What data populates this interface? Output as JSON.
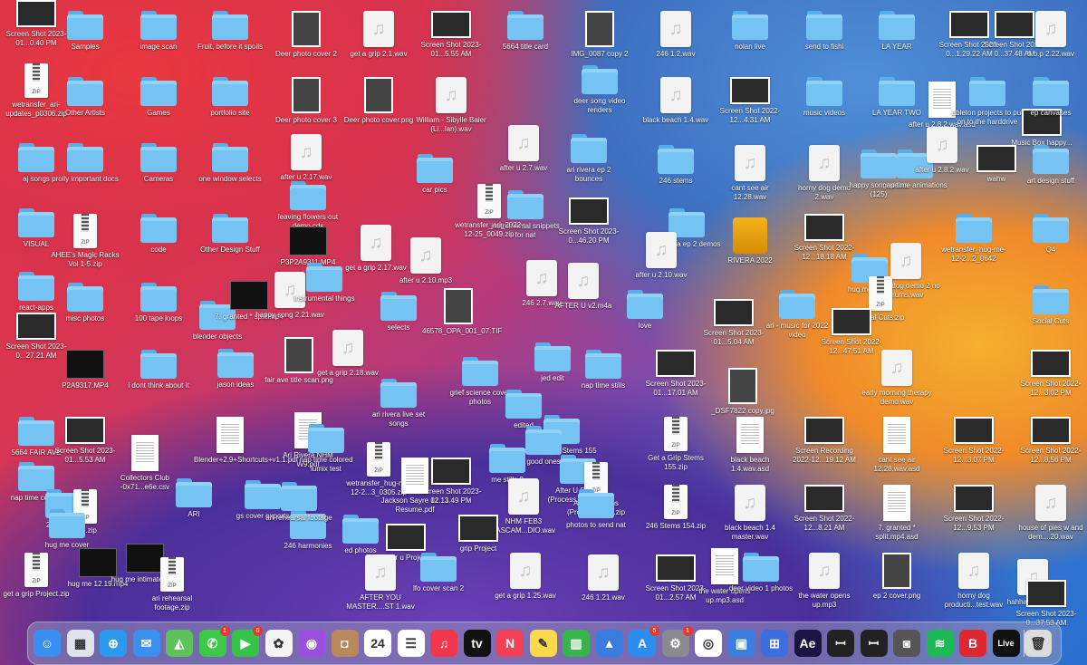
{
  "desktop": {
    "items": [
      {
        "label": "Samples",
        "kind": "folder"
      },
      {
        "label": "image scan",
        "kind": "folder"
      },
      {
        "label": "Fruit, before it spoils",
        "kind": "folder"
      },
      {
        "label": "Deer photo cover 2",
        "kind": "photo"
      },
      {
        "label": "get a grip 2.1.wav",
        "kind": "audio"
      },
      {
        "label": "Screen Shot 2023-01...5.55 AM",
        "kind": "shot"
      },
      {
        "label": "5664 title card",
        "kind": "folder"
      },
      {
        "label": "IMG_0087 copy 2",
        "kind": "photo"
      },
      {
        "label": "246 1.2.wav",
        "kind": "audio"
      },
      {
        "label": "nolan live",
        "kind": "folder"
      },
      {
        "label": "send to fishi",
        "kind": "folder"
      },
      {
        "label": "LA YEAR",
        "kind": "folder"
      },
      {
        "label": "Screen Shot 2023-0...1.29.22 AM",
        "kind": "shot"
      },
      {
        "label": "Screen Shot 2023-0...37.48 AM",
        "kind": "shot"
      },
      {
        "label": "h.o.p 2.22.wav",
        "kind": "audio"
      },
      {
        "label": "wetransfer_ari-updates_p0306.zip",
        "kind": "zip"
      },
      {
        "label": "Other Artists",
        "kind": "folder"
      },
      {
        "label": "Games",
        "kind": "folder"
      },
      {
        "label": "portfolio site",
        "kind": "folder"
      },
      {
        "label": "Deer photo cover 3",
        "kind": "photo"
      },
      {
        "label": "Deer photo cover.png",
        "kind": "photo"
      },
      {
        "label": "William - Sibylle Baier (Li...lan).wav",
        "kind": "audio"
      },
      {
        "label": "deer song video renders",
        "kind": "folder"
      },
      {
        "label": "black beach 1.4.wav",
        "kind": "audio"
      },
      {
        "label": "Screen Shot 2022-12...4.31 AM",
        "kind": "shot"
      },
      {
        "label": "music videos",
        "kind": "folder"
      },
      {
        "label": "LA YEAR TWO",
        "kind": "folder"
      },
      {
        "label": "after u 2.8.2.wav.asd",
        "kind": "doc"
      },
      {
        "label": "ableton projects to put on to the harddrive",
        "kind": "folder"
      },
      {
        "label": "Music Box happy...",
        "kind": "shot"
      },
      {
        "label": "ep canvases",
        "kind": "folder"
      },
      {
        "label": "aj songs",
        "kind": "folder"
      },
      {
        "label": "prolly important docs",
        "kind": "folder"
      },
      {
        "label": "Cameras",
        "kind": "folder"
      },
      {
        "label": "one window selects",
        "kind": "folder"
      },
      {
        "label": "after u 2.17.wav",
        "kind": "audio"
      },
      {
        "label": "after u 2.7.wav",
        "kind": "audio"
      },
      {
        "label": "ari rivera ep 2 bounces",
        "kind": "folder"
      },
      {
        "label": "246 stems",
        "kind": "folder"
      },
      {
        "label": "cant see air 12.28.wav",
        "kind": "audio"
      },
      {
        "label": "horny dog demo 2.wav",
        "kind": "audio"
      },
      {
        "label": "happy song stems (125)",
        "kind": "folder"
      },
      {
        "label": "nap time animations",
        "kind": "folder"
      },
      {
        "label": "after u 2.8.2.wav",
        "kind": "audio"
      },
      {
        "label": "wahw",
        "kind": "shot"
      },
      {
        "label": "art design stuff",
        "kind": "folder"
      },
      {
        "label": "VISUAL",
        "kind": "folder"
      },
      {
        "label": "AHEE's Magic Racks Vol 1-5.zip",
        "kind": "zip"
      },
      {
        "label": "code",
        "kind": "folder"
      },
      {
        "label": "Other Design Stuff",
        "kind": "folder"
      },
      {
        "label": "leaving flowers out demo cds",
        "kind": "folder"
      },
      {
        "label": "car pics",
        "kind": "folder"
      },
      {
        "label": "instrumental snippets for nat",
        "kind": "folder"
      },
      {
        "label": "Screen Shot 2023-0...46.20 PM",
        "kind": "shot"
      },
      {
        "label": "ari rivera ep 2 demos",
        "kind": "folder"
      },
      {
        "label": "RIVERA 2022",
        "kind": "drive"
      },
      {
        "label": "Screen Shot 2022-12...18.18 AM",
        "kind": "shot"
      },
      {
        "label": "horny dog demo 2 no drums.wav",
        "kind": "audio"
      },
      {
        "label": "wetransfer_hug-me-12-2...2_0642",
        "kind": "folder"
      },
      {
        "label": "Q4",
        "kind": "folder"
      },
      {
        "label": "react-apps",
        "kind": "folder"
      },
      {
        "label": "P3P2A9311.MP4",
        "kind": "video"
      },
      {
        "label": "get a grip 2.17.wav",
        "kind": "audio"
      },
      {
        "label": "after u 2.10.mp3",
        "kind": "audio"
      },
      {
        "label": "246 2.7.wav",
        "kind": "audio"
      },
      {
        "label": "AFTER U v2.m4a",
        "kind": "audio"
      },
      {
        "label": "after u 2.10.wav",
        "kind": "audio"
      },
      {
        "label": "hug me video",
        "kind": "folder"
      },
      {
        "label": "Social Cuts.zip",
        "kind": "zip"
      },
      {
        "label": "Social Cuts",
        "kind": "folder"
      },
      {
        "label": "misc photos",
        "kind": "folder"
      },
      {
        "label": "100 tape loops",
        "kind": "folder"
      },
      {
        "label": "blender objects",
        "kind": "folder"
      },
      {
        "label": "7. granted * split.mp4",
        "kind": "video"
      },
      {
        "label": "happy song 2.21.wav",
        "kind": "audio"
      },
      {
        "label": "instrumental things",
        "kind": "folder"
      },
      {
        "label": "selects",
        "kind": "folder"
      },
      {
        "label": "46578_OPA_001_07.TIF",
        "kind": "photo"
      },
      {
        "label": "love",
        "kind": "folder"
      },
      {
        "label": "Screen Shot 2023-01...5.04 AM",
        "kind": "shot"
      },
      {
        "label": "ari - music for 2022 video",
        "kind": "folder"
      },
      {
        "label": "Screen Shot 2022-12...47.51 AM",
        "kind": "shot"
      },
      {
        "label": "wetransfer_ari_2022-12-25_0049.zip",
        "kind": "zip"
      },
      {
        "label": "Screen Shot 2023-0...27.21 AM",
        "kind": "shot"
      },
      {
        "label": "P2A9317.MP4",
        "kind": "video"
      },
      {
        "label": "i dont think about it",
        "kind": "folder"
      },
      {
        "label": "jason ideas",
        "kind": "folder"
      },
      {
        "label": "fair ave title scan.png",
        "kind": "photo"
      },
      {
        "label": "get a grip 2.18.wav",
        "kind": "audio"
      },
      {
        "label": "grief science cover photos",
        "kind": "folder"
      },
      {
        "label": "jed edit",
        "kind": "folder"
      },
      {
        "label": "nap time stills",
        "kind": "folder"
      },
      {
        "label": "Screen Shot 2023-01...17.01 AM",
        "kind": "shot"
      },
      {
        "label": "early morning therapy demo.wav",
        "kind": "audio"
      },
      {
        "label": "Screen Shot 2022-12...3.02 PM",
        "kind": "shot"
      },
      {
        "label": "5664 FAIR AVE",
        "kind": "folder"
      },
      {
        "label": "Ari Rivera NHM W9.pdf",
        "kind": "doc"
      },
      {
        "label": "ari rivera live set songs",
        "kind": "folder"
      },
      {
        "label": "edited",
        "kind": "folder"
      },
      {
        "label": "Get a Grip Stems 155",
        "kind": "folder"
      },
      {
        "label": "_DSF7822 copy.jpg",
        "kind": "photo"
      },
      {
        "label": "Screen Shot 2023-01...5.53 AM",
        "kind": "shot"
      },
      {
        "label": "Blender+2.9+Shortcuts+v1.1.pdf",
        "kind": "doc"
      },
      {
        "label": "nap time colored lumix test",
        "kind": "folder"
      },
      {
        "label": "good ones",
        "kind": "folder"
      },
      {
        "label": "Get a Grip Stems 155.zip",
        "kind": "zip"
      },
      {
        "label": "black beach 1.4.wav.asd",
        "kind": "doc"
      },
      {
        "label": "Screen Recording 2022-12...19.12 AM",
        "kind": "shot"
      },
      {
        "label": "cant see air 12.28.wav.asd",
        "kind": "doc"
      },
      {
        "label": "Screen Shot 2022-12...3.07 PM",
        "kind": "shot"
      },
      {
        "label": "Screen Shot 2022-12...8.56 PM",
        "kind": "shot"
      },
      {
        "label": "nap time covers",
        "kind": "folder"
      },
      {
        "label": "Collectors Club -0x71...e6e.csv",
        "kind": "doc"
      },
      {
        "label": "wetransfer_hug-me-12-2...3_0305.zip",
        "kind": "zip"
      },
      {
        "label": "Screen Shot 2023-01...1.49 PM",
        "kind": "shot"
      },
      {
        "label": "me stills 2",
        "kind": "folder"
      },
      {
        "label": "After U Stems (Process...cal) 108",
        "kind": "folder"
      },
      {
        "label": "246 Stems",
        "kind": "folder"
      },
      {
        "label": "ARI.zip",
        "kind": "zip"
      },
      {
        "label": "Jackson Sayre 12.13 Resume.pdf",
        "kind": "doc"
      },
      {
        "label": "NHM FEB3 TASCAM...DIO.wav",
        "kind": "audio"
      },
      {
        "label": "After U Stems (Process...108.zip",
        "kind": "zip"
      },
      {
        "label": "246 Stems 154.zip",
        "kind": "zip"
      },
      {
        "label": "black beach 1.4 master.wav",
        "kind": "audio"
      },
      {
        "label": "Screen Shot 2022-12...8.21 AM",
        "kind": "shot"
      },
      {
        "label": "7. granted * split.mp4.asd",
        "kind": "doc"
      },
      {
        "label": "Screen Shot 2022-12...9.53 PM",
        "kind": "shot"
      },
      {
        "label": "house of pies w and dem....20.wav",
        "kind": "audio"
      },
      {
        "label": "hug me cover",
        "kind": "folder"
      },
      {
        "label": "ARI",
        "kind": "folder"
      },
      {
        "label": "gs cover exports",
        "kind": "folder"
      },
      {
        "label": "photos to send nat",
        "kind": "folder"
      },
      {
        "label": "246 harmonies",
        "kind": "folder"
      },
      {
        "label": "ed photos",
        "kind": "folder"
      },
      {
        "label": "after u Project",
        "kind": "shot"
      },
      {
        "label": "grip Project",
        "kind": "shot"
      },
      {
        "label": "get a grip Project.zip",
        "kind": "zip"
      },
      {
        "label": "hug me 12.19.mp4",
        "kind": "video"
      },
      {
        "label": "hug me intimate.mp4",
        "kind": "video"
      },
      {
        "label": "ari rehearsal footage.zip",
        "kind": "zip"
      },
      {
        "label": "ari rehearsal footage",
        "kind": "folder"
      },
      {
        "label": "AFTER YOU MASTER....ST 1.wav",
        "kind": "audio"
      },
      {
        "label": "lfo cover scan 2",
        "kind": "folder"
      },
      {
        "label": "get a grip 1.25.wav",
        "kind": "audio"
      },
      {
        "label": "246 1.21.wav",
        "kind": "audio"
      },
      {
        "label": "Screen Shot 2023-01...2.57 AM",
        "kind": "shot"
      },
      {
        "label": "the water opens up.mp3.asd",
        "kind": "doc"
      },
      {
        "label": "deer video 1 photos",
        "kind": "folder"
      },
      {
        "label": "the water opens up.mp3",
        "kind": "audio"
      },
      {
        "label": "ep 2 cover.png",
        "kind": "photo"
      },
      {
        "label": "horny dog producti...test.wav",
        "kind": "audio"
      },
      {
        "label": "hahhahaha.wav",
        "kind": "audio"
      },
      {
        "label": "Screen Shot 2023-0...37.53 AM",
        "kind": "shot"
      },
      {
        "label": "Screen Shot 2023-01...0.40 PM",
        "kind": "shot"
      }
    ]
  },
  "dock": {
    "apps": [
      {
        "name": "Finder",
        "icon": "finder-icon",
        "color": "#3a8ef0",
        "glyph": "☺"
      },
      {
        "name": "Launchpad",
        "icon": "launchpad-icon",
        "color": "#e0e3ea",
        "glyph": "▦"
      },
      {
        "name": "Safari",
        "icon": "safari-icon",
        "color": "#2a9af0",
        "glyph": "⊕"
      },
      {
        "name": "Mail",
        "icon": "mail-icon",
        "color": "#3a90ef",
        "glyph": "✉"
      },
      {
        "name": "Maps",
        "icon": "maps-icon",
        "color": "#5cc35a",
        "glyph": "◭"
      },
      {
        "name": "Messages",
        "icon": "messages-icon",
        "color": "#3cc94a",
        "glyph": "✆",
        "badge": "1"
      },
      {
        "name": "FaceTime",
        "icon": "facetime-icon",
        "color": "#35c447",
        "glyph": "▶",
        "badge": "6"
      },
      {
        "name": "Photos",
        "icon": "photos-icon",
        "color": "#f4f4f4",
        "glyph": "✿"
      },
      {
        "name": "Podcasts",
        "icon": "podcasts-icon",
        "color": "#9a4fe0",
        "glyph": "◉"
      },
      {
        "name": "Contacts",
        "icon": "contacts-icon",
        "color": "#b9895c",
        "glyph": "◘"
      },
      {
        "name": "Calendar",
        "icon": "calendar-icon",
        "color": "#ffffff",
        "glyph": "24"
      },
      {
        "name": "Reminders",
        "icon": "reminders-icon",
        "color": "#ffffff",
        "glyph": "☰"
      },
      {
        "name": "Music",
        "icon": "music-icon",
        "color": "#f0374e",
        "glyph": "♫"
      },
      {
        "name": "TV",
        "icon": "tv-icon",
        "color": "#111111",
        "glyph": "tv"
      },
      {
        "name": "News",
        "icon": "news-icon",
        "color": "#f04156",
        "glyph": "N"
      },
      {
        "name": "Notes",
        "icon": "notes-icon",
        "color": "#fcd94a",
        "glyph": "✎"
      },
      {
        "name": "Numbers",
        "icon": "numbers-icon",
        "color": "#37b54a",
        "glyph": "▥"
      },
      {
        "name": "Keynote",
        "icon": "keynote-icon",
        "color": "#3a7de0",
        "glyph": "▲"
      },
      {
        "name": "App Store",
        "icon": "appstore-icon",
        "color": "#2a8ef0",
        "glyph": "A",
        "badge": "5"
      },
      {
        "name": "System Preferences",
        "icon": "settings-icon",
        "color": "#8a8a90",
        "glyph": "⚙",
        "badge": "1"
      },
      {
        "name": "Chrome",
        "icon": "chrome-icon",
        "color": "#ffffff",
        "glyph": "◎"
      },
      {
        "name": "Preview",
        "icon": "preview-icon",
        "color": "#3a7fe0",
        "glyph": "▣"
      },
      {
        "name": "Image Capture",
        "icon": "image-capture-icon",
        "color": "#3d6ee0",
        "glyph": "⊞"
      },
      {
        "name": "After Effects",
        "icon": "aftereffects-icon",
        "color": "#1b1442",
        "glyph": "Ae"
      },
      {
        "name": "UAD Console",
        "icon": "uad-icon",
        "color": "#222222",
        "glyph": "ꟷ"
      },
      {
        "name": "UAD Meter",
        "icon": "uad-meter-icon",
        "color": "#222222",
        "glyph": "ꟷ"
      },
      {
        "name": "Screenshot",
        "icon": "screenshot-icon",
        "color": "#555555",
        "glyph": "◙"
      },
      {
        "name": "Spotify",
        "icon": "spotify-icon",
        "color": "#1db954",
        "glyph": "≋"
      },
      {
        "name": "Bandcamp",
        "icon": "bandcamp-icon",
        "color": "#e0262f",
        "glyph": "B"
      },
      {
        "name": "Ableton Live",
        "icon": "ableton-icon",
        "color": "#111111",
        "glyph": "Live"
      },
      {
        "name": "Trash",
        "icon": "trash-icon",
        "color": "#dcdcdc",
        "glyph": "🗑"
      }
    ]
  }
}
